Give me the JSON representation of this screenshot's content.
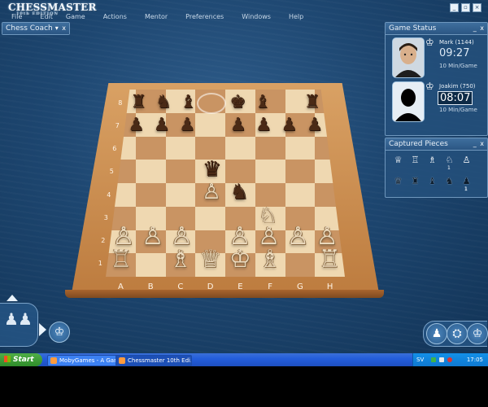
{
  "app": {
    "logo": "CHESSMASTER",
    "logo_sub": "10th EDITION",
    "menu": [
      "File",
      "Edit",
      "Game",
      "Actions",
      "Mentor",
      "Preferences",
      "Windows",
      "Help"
    ]
  },
  "coach": {
    "title": "Chess Coach",
    "controls": "▾ x"
  },
  "game_status": {
    "title": "Game Status",
    "controls": "_ x",
    "players": [
      {
        "name": "Mark (1144)",
        "clock": "09:27",
        "mode": "10 Min/Game",
        "active": false,
        "color": "white"
      },
      {
        "name": "Joakim (750)",
        "clock": "08:07",
        "mode": "10 Min/Game",
        "active": true,
        "color": "black"
      }
    ]
  },
  "captured": {
    "title": "Captured Pieces",
    "controls": "_ x",
    "white_row": [
      {
        "glyph": "♕",
        "count": ""
      },
      {
        "glyph": "♖",
        "count": ""
      },
      {
        "glyph": "♗",
        "count": ""
      },
      {
        "glyph": "♘",
        "count": "1"
      },
      {
        "glyph": "♙",
        "count": ""
      }
    ],
    "black_row": [
      {
        "glyph": "♛",
        "count": ""
      },
      {
        "glyph": "♜",
        "count": ""
      },
      {
        "glyph": "♝",
        "count": ""
      },
      {
        "glyph": "♞",
        "count": ""
      },
      {
        "glyph": "♟",
        "count": "1"
      }
    ]
  },
  "board": {
    "files": [
      "A",
      "B",
      "C",
      "D",
      "E",
      "F",
      "G",
      "H"
    ],
    "ranks": [
      "8",
      "7",
      "6",
      "5",
      "4",
      "3",
      "2",
      "1"
    ],
    "highlight_square": "d8",
    "pieces": [
      {
        "sq": "a8",
        "p": "♜",
        "c": "black"
      },
      {
        "sq": "b8",
        "p": "♞",
        "c": "black"
      },
      {
        "sq": "c8",
        "p": "♝",
        "c": "black"
      },
      {
        "sq": "e8",
        "p": "♚",
        "c": "black"
      },
      {
        "sq": "f8",
        "p": "♝",
        "c": "black"
      },
      {
        "sq": "h8",
        "p": "♜",
        "c": "black"
      },
      {
        "sq": "a7",
        "p": "♟",
        "c": "black"
      },
      {
        "sq": "b7",
        "p": "♟",
        "c": "black"
      },
      {
        "sq": "c7",
        "p": "♟",
        "c": "black"
      },
      {
        "sq": "e7",
        "p": "♟",
        "c": "black"
      },
      {
        "sq": "f7",
        "p": "♟",
        "c": "black"
      },
      {
        "sq": "g7",
        "p": "♟",
        "c": "black"
      },
      {
        "sq": "h7",
        "p": "♟",
        "c": "black"
      },
      {
        "sq": "d5",
        "p": "♛",
        "c": "black"
      },
      {
        "sq": "e4",
        "p": "♞",
        "c": "black"
      },
      {
        "sq": "d4",
        "p": "♙",
        "c": "white"
      },
      {
        "sq": "f3",
        "p": "♘",
        "c": "white"
      },
      {
        "sq": "a2",
        "p": "♙",
        "c": "white"
      },
      {
        "sq": "b2",
        "p": "♙",
        "c": "white"
      },
      {
        "sq": "c2",
        "p": "♙",
        "c": "white"
      },
      {
        "sq": "e2",
        "p": "♙",
        "c": "white"
      },
      {
        "sq": "f2",
        "p": "♙",
        "c": "white"
      },
      {
        "sq": "g2",
        "p": "♙",
        "c": "white"
      },
      {
        "sq": "h2",
        "p": "♙",
        "c": "white"
      },
      {
        "sq": "a1",
        "p": "♖",
        "c": "white"
      },
      {
        "sq": "c1",
        "p": "♗",
        "c": "white"
      },
      {
        "sq": "d1",
        "p": "♕",
        "c": "white"
      },
      {
        "sq": "e1",
        "p": "♔",
        "c": "white"
      },
      {
        "sq": "f1",
        "p": "♗",
        "c": "white"
      },
      {
        "sq": "h1",
        "p": "♖",
        "c": "white"
      }
    ]
  },
  "dock": {
    "left_pieces": [
      "♟",
      "♟"
    ],
    "left_button": "♔",
    "right_buttons": [
      "♟",
      "⛭",
      "♔"
    ]
  },
  "taskbar": {
    "start": "Start",
    "items": [
      {
        "label": "MobyGames - A Gam...",
        "active": false
      },
      {
        "label": "Chessmaster 10th Edi...",
        "active": true
      }
    ],
    "tray_lang": "SV",
    "clock": "17:05"
  },
  "colors": {
    "light_square": "#efd8b1",
    "dark_square": "#c99463",
    "panel": "#24507c",
    "taskbar": "#245edb"
  }
}
